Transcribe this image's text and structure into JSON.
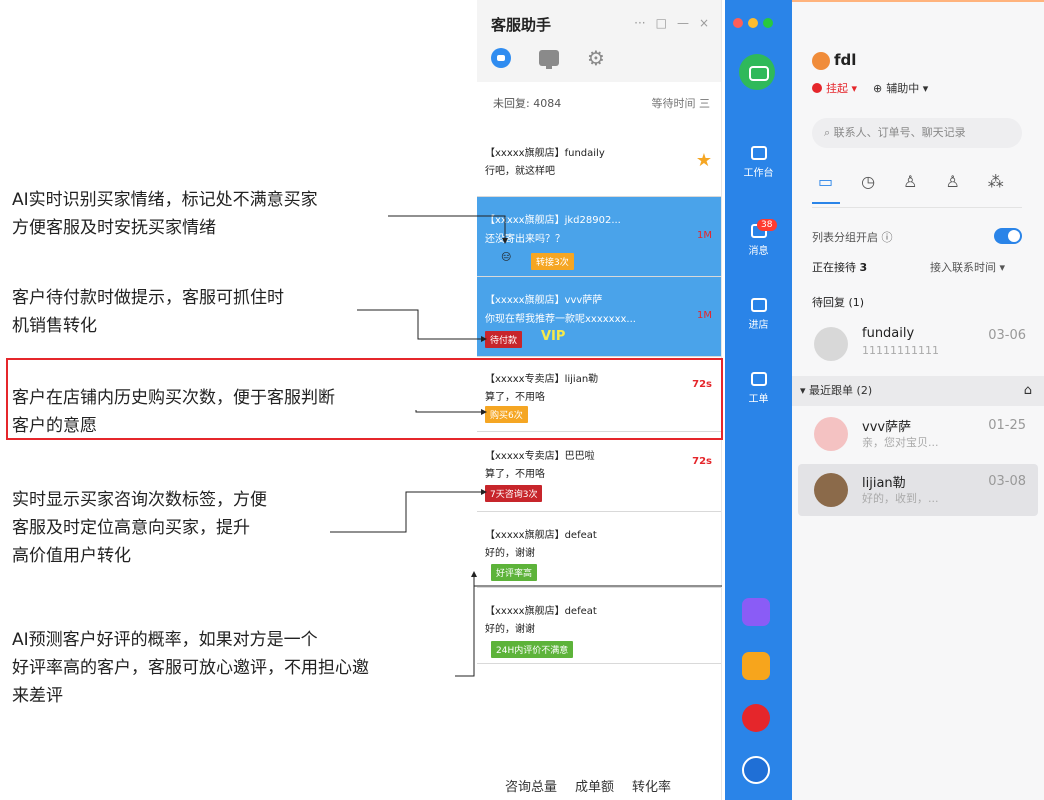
{
  "annotations": [
    {
      "id": "mood",
      "lines": [
        "AI实时识别买家情绪，标记处不满意买家",
        "方便客服及时安抚买家情绪"
      ]
    },
    {
      "id": "pay",
      "lines": [
        "客户待付款时做提示，客服可抓住时",
        "机销售转化"
      ]
    },
    {
      "id": "history",
      "lines": [
        "客户在店铺内历史购买次数，便于客服判断",
        "客户的意愿"
      ]
    },
    {
      "id": "consult",
      "lines": [
        "实时显示买家咨询次数标签，方便",
        "客服及时定位高意向买家，提升",
        "高价值用户转化"
      ]
    },
    {
      "id": "review",
      "lines": [
        "AI预测客户好评的概率，如果对方是一个",
        "好评率高的客户，客服可放心邀评，不用担心邀",
        "来差评"
      ]
    }
  ],
  "assistant": {
    "title": "客服助手",
    "window_controls": [
      "···",
      "□",
      "—",
      "×"
    ],
    "top_icons": [
      "assistant-icon",
      "monitor-icon",
      "gear-icon"
    ],
    "unreplied_label": "未回复: 4084",
    "sort_label": "等待时间 三",
    "sessions": [
      {
        "shop": "【xxxxx旗舰店】fundaily",
        "message": "行吧，就这样吧",
        "time": "",
        "tag": "",
        "starred": true
      },
      {
        "shop": "【xxxxx旗舰店】jkd28902...",
        "message": "还没寄出来吗？？",
        "time": "1M",
        "tag": "转接3次",
        "emoji": "😑"
      },
      {
        "shop": "【xxxxx旗舰店】vvv萨萨",
        "message": "你现在帮我推荐一款呢xxxxxxx...",
        "time": "1M",
        "tag": "待付款",
        "vip": "VIP"
      },
      {
        "shop": "【xxxxx专卖店】lijian勒",
        "message": "算了，不用咯",
        "time": "72s",
        "tag": "购买6次"
      },
      {
        "shop": "【xxxxx专卖店】巴巴啦",
        "message": "算了，不用咯",
        "time": "72s",
        "tag": "7天咨询3次"
      },
      {
        "shop": "【xxxxx旗舰店】defeat",
        "message": "好的，谢谢",
        "time": "",
        "tag": "好评率高"
      },
      {
        "shop": "【xxxxx旗舰店】defeat",
        "message": "好的，谢谢",
        "time": "",
        "tag": "24H内评价不满意"
      }
    ],
    "stats": [
      "咨询总量",
      "成单额",
      "转化率"
    ]
  },
  "nav": {
    "items": [
      {
        "label": "工作台",
        "icon": "workbench-icon"
      },
      {
        "label": "消息",
        "icon": "message-icon",
        "badge": "38"
      },
      {
        "label": "进店",
        "icon": "store-icon"
      },
      {
        "label": "工单",
        "icon": "ticket-icon"
      }
    ],
    "colors": {
      "bar": "#2a84e8",
      "accent": "#e5262b"
    }
  },
  "chat": {
    "user_name": "fdl",
    "status": "挂起",
    "assist_status": "辅助中",
    "search_placeholder": "联系人、订单号、聊天记录",
    "group_toggle_label": "列表分组开启",
    "receiving_label": "正在接待",
    "receiving_count": "3",
    "sort_label": "接入联系时间",
    "pending_label": "待回复 (1)",
    "recent_label": "最近跟单 (2)",
    "contacts": [
      {
        "name": "fundaily",
        "preview": "11111111111",
        "date": "03-06"
      },
      {
        "name": "vvv萨萨",
        "preview": "亲，您对宝贝...",
        "date": "01-25"
      },
      {
        "name": "lijian勒",
        "preview": "好的，收到，...",
        "date": "03-08"
      }
    ]
  }
}
